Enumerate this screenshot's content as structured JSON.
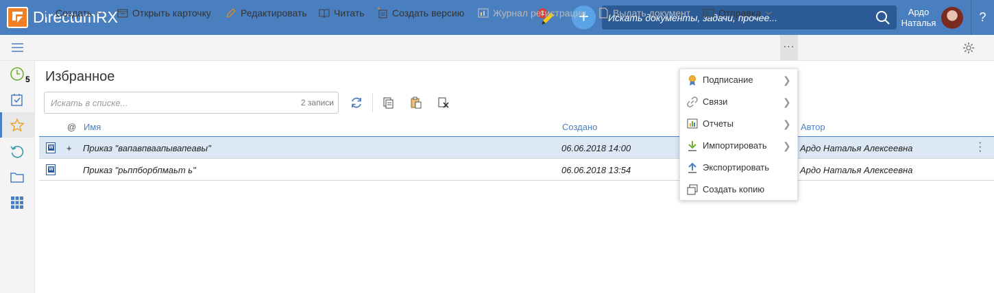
{
  "header": {
    "app_title": "DirectumRX",
    "notification_count": "1",
    "search_placeholder": "Искать документы, задачи, прочее...",
    "user_first": "Ардо",
    "user_last": "Наталья",
    "help": "?",
    "brand_color": "#4a7fbf",
    "logo_color": "#f07f25"
  },
  "toolbar": {
    "create": "Создать",
    "open_card": "Открыть карточку",
    "edit": "Редактировать",
    "read": "Читать",
    "create_version": "Создать версию",
    "registration_log": "Журнал регистрации",
    "issue_document": "Выдать документ",
    "send": "Отправка",
    "more": "···"
  },
  "leftnav": {
    "items": [
      {
        "icon": "clock-icon",
        "count": "5"
      },
      {
        "icon": "task-check-icon"
      },
      {
        "icon": "star-icon",
        "active": true
      },
      {
        "icon": "history-icon"
      },
      {
        "icon": "folder-icon"
      },
      {
        "icon": "apps-grid-icon"
      }
    ]
  },
  "main": {
    "title": "Избранное",
    "list_search_placeholder": "Искать в списке...",
    "record_count": "2 записи",
    "columns": {
      "at": "@",
      "name": "Имя",
      "created": "Создано",
      "author": "Автор"
    },
    "rows": [
      {
        "expand": "+",
        "name": "Приказ \"вапавпваапывапеавы\"",
        "created": "06.06.2018 14:00",
        "author": "Ардо Наталья Алексеевна",
        "selected": true
      },
      {
        "expand": "",
        "name": "Приказ \"рьппборбпмаьт ь\"",
        "created": "06.06.2018 13:54",
        "author": "Ардо Наталья Алексеевна",
        "selected": false
      }
    ]
  },
  "menu": {
    "items": [
      {
        "label": "Подписание",
        "icon": "signature-icon",
        "submenu": true
      },
      {
        "label": "Связи",
        "icon": "link-icon",
        "submenu": true
      },
      {
        "label": "Отчеты",
        "icon": "report-icon",
        "submenu": true
      },
      {
        "label": "Импортировать",
        "icon": "import-icon",
        "submenu": true
      },
      {
        "label": "Экспортировать",
        "icon": "export-icon",
        "submenu": false
      },
      {
        "label": "Создать копию",
        "icon": "copy-icon",
        "submenu": false
      }
    ]
  }
}
